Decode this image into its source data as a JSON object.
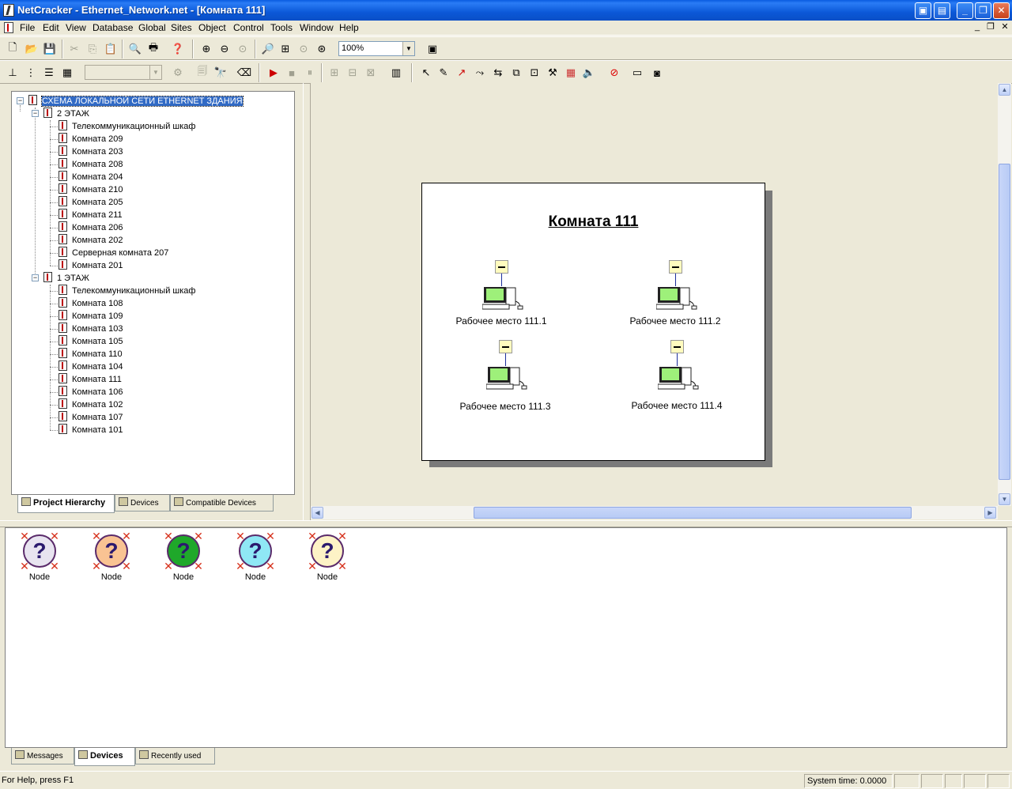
{
  "window": {
    "title": "NetCracker - Ethernet_Network.net - [Комната 111]"
  },
  "menu": {
    "items": [
      "File",
      "Edit",
      "View",
      "Database",
      "Global",
      "Sites",
      "Object",
      "Control",
      "Tools",
      "Window",
      "Help"
    ]
  },
  "toolbar": {
    "zoom_value": "100%"
  },
  "tree": {
    "root": "СХЕМА ЛОКАЛЬНОЙ СЕТИ ETHERNET ЗДАНИЯ",
    "floors": [
      {
        "label": "2 ЭТАЖ",
        "rooms": [
          "Телекоммуникационный шкаф",
          "Комната 209",
          "Комната 203",
          "Комната 208",
          "Комната 204",
          "Комната 210",
          "Комната 205",
          "Комната 211",
          "Комната 206",
          "Комната 202",
          "Серверная комната 207",
          "Комната 201"
        ]
      },
      {
        "label": "1 ЭТАЖ",
        "rooms": [
          "Телекоммуникационный шкаф",
          "Комната 108",
          "Комната 109",
          "Комната 103",
          "Комната 105",
          "Комната 110",
          "Комната 104",
          "Комната 111",
          "Комната 106",
          "Комната 102",
          "Комната 107",
          "Комната 101"
        ]
      }
    ]
  },
  "left_tabs": [
    "Project Hierarchy",
    "Devices",
    "Compatible Devices"
  ],
  "sheet": {
    "title": "Комната 111",
    "workstations": [
      "Рабочее место 111.1",
      "Рабочее место 111.2",
      "Рабочее место 111.3",
      "Рабочее место 111.4"
    ]
  },
  "palette": {
    "nodes": [
      {
        "label": "Node",
        "color": "#e8e4f0"
      },
      {
        "label": "Node",
        "color": "#f9c393"
      },
      {
        "label": "Node",
        "color": "#1fa82a"
      },
      {
        "label": "Node",
        "color": "#8fe8f5"
      },
      {
        "label": "Node",
        "color": "#fdf3c6"
      }
    ]
  },
  "bottom_tabs": [
    "Messages",
    "Devices",
    "Recently used"
  ],
  "status": {
    "help": "For Help, press F1",
    "system_time": "System time: 0.0000"
  }
}
